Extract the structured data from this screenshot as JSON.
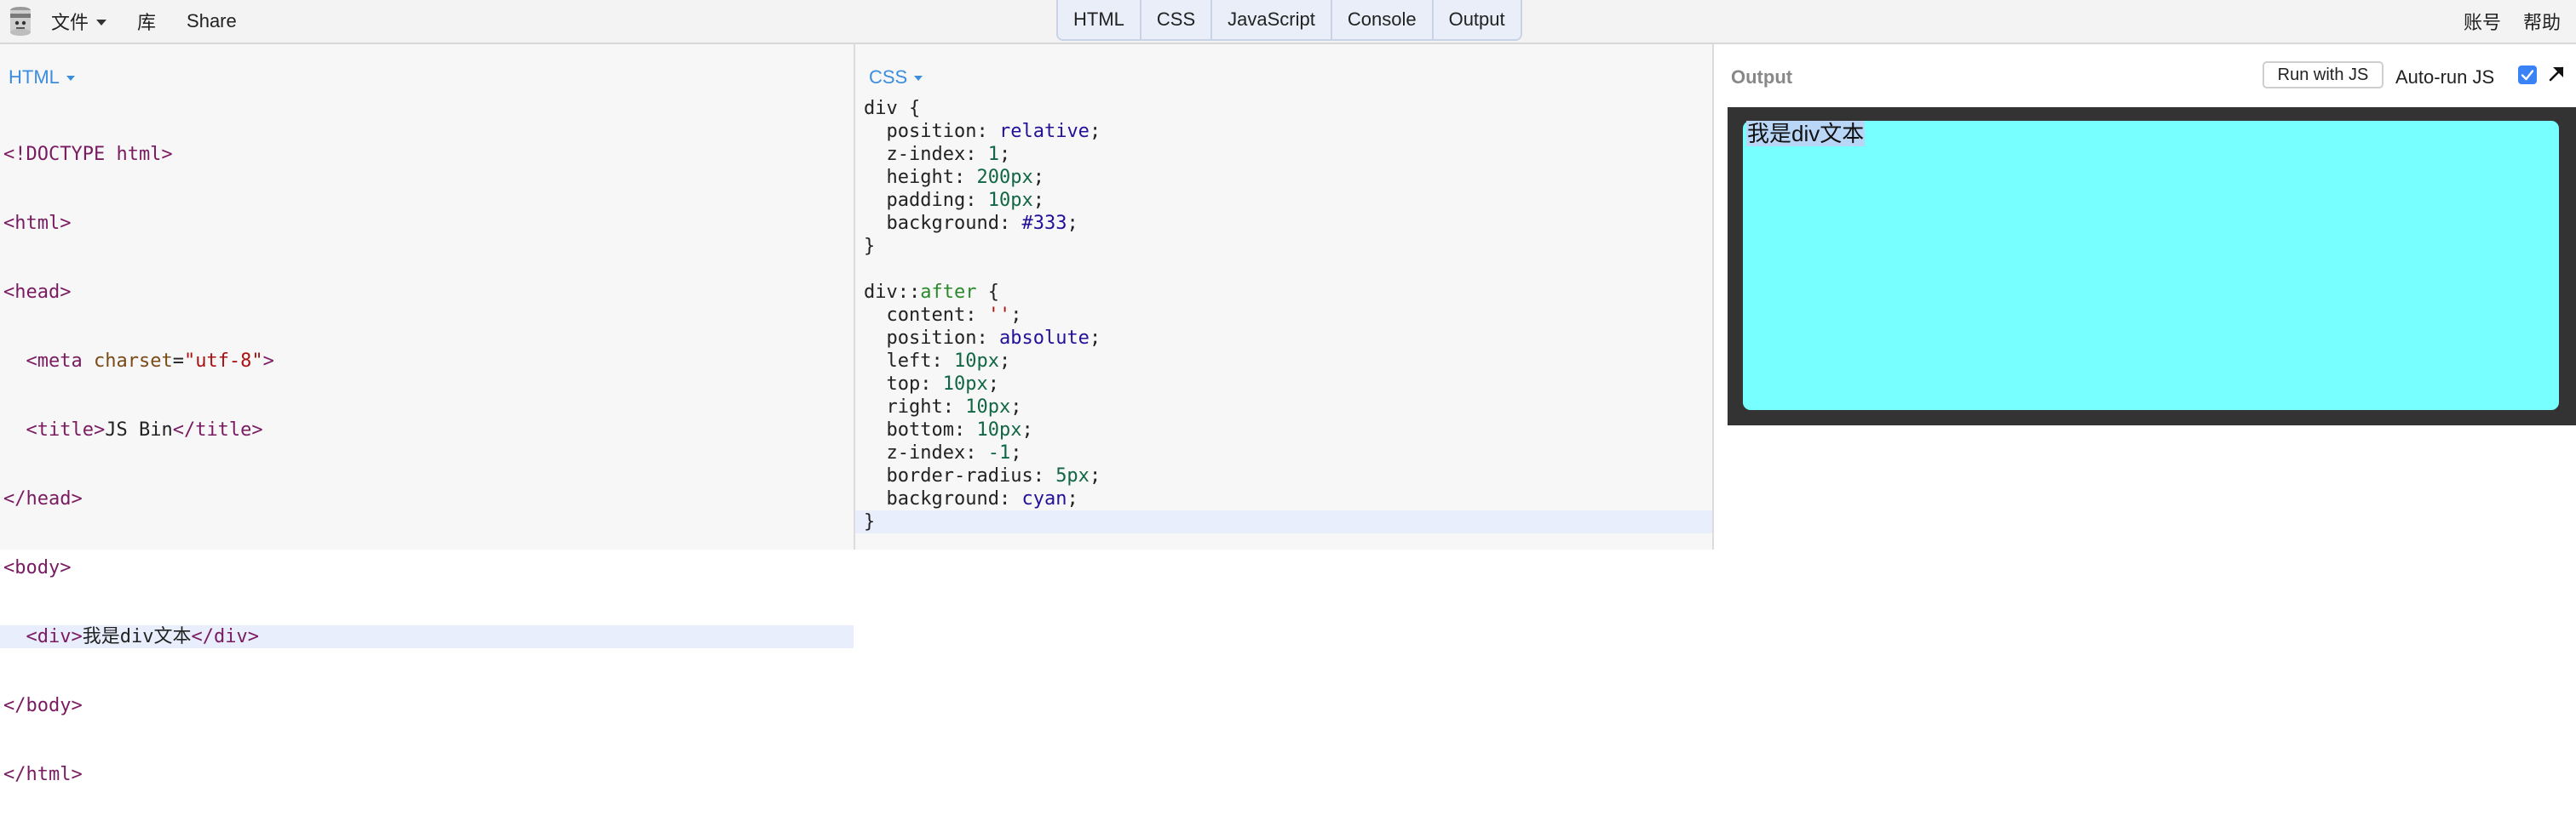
{
  "topbar": {
    "menu_left": [
      {
        "label": "文件",
        "has_caret": true
      },
      {
        "label": "库",
        "has_caret": false
      },
      {
        "label": "Share",
        "has_caret": false
      }
    ],
    "tabs": [
      {
        "label": "HTML"
      },
      {
        "label": "CSS"
      },
      {
        "label": "JavaScript"
      },
      {
        "label": "Console"
      },
      {
        "label": "Output"
      }
    ],
    "menu_right": [
      {
        "label": "账号"
      },
      {
        "label": "帮助"
      }
    ]
  },
  "html_panel": {
    "label": "HTML",
    "lines": [
      "<!DOCTYPE html>",
      "<html>",
      "<head>",
      "  <meta charset=\"utf-8\">",
      "  <title>JS Bin</title>",
      "</head>",
      "<body>",
      "  <div>我是div文本</div>",
      "</body>",
      "</html>"
    ]
  },
  "css_panel": {
    "label": "CSS",
    "lines": [
      "div {",
      "  position: relative;",
      "  z-index: 1;",
      "  height: 200px;",
      "  padding: 10px;",
      "  background: #333;",
      "}",
      "",
      "div::after {",
      "  content: '';",
      "  position: absolute;",
      "  left: 10px;",
      "  top: 10px;",
      "  right: 10px;",
      "  bottom: 10px;",
      "  z-index: -1;",
      "  border-radius: 5px;",
      "  background: cyan;",
      "}"
    ]
  },
  "output_panel": {
    "title": "Output",
    "run_button": "Run with JS",
    "autorun_label": "Auto-run JS",
    "preview_text": "我是div文本"
  },
  "colors": {
    "accent": "#3c8dde",
    "preview_outer": "#333333",
    "preview_inner": "#77ffff",
    "checkbox": "#3b82f6"
  },
  "icons": {
    "logo": "jsbin-logo-icon",
    "menu_caret": "caret-down-icon",
    "expand": "expand-arrow-icon",
    "check": "checkmark-icon"
  }
}
